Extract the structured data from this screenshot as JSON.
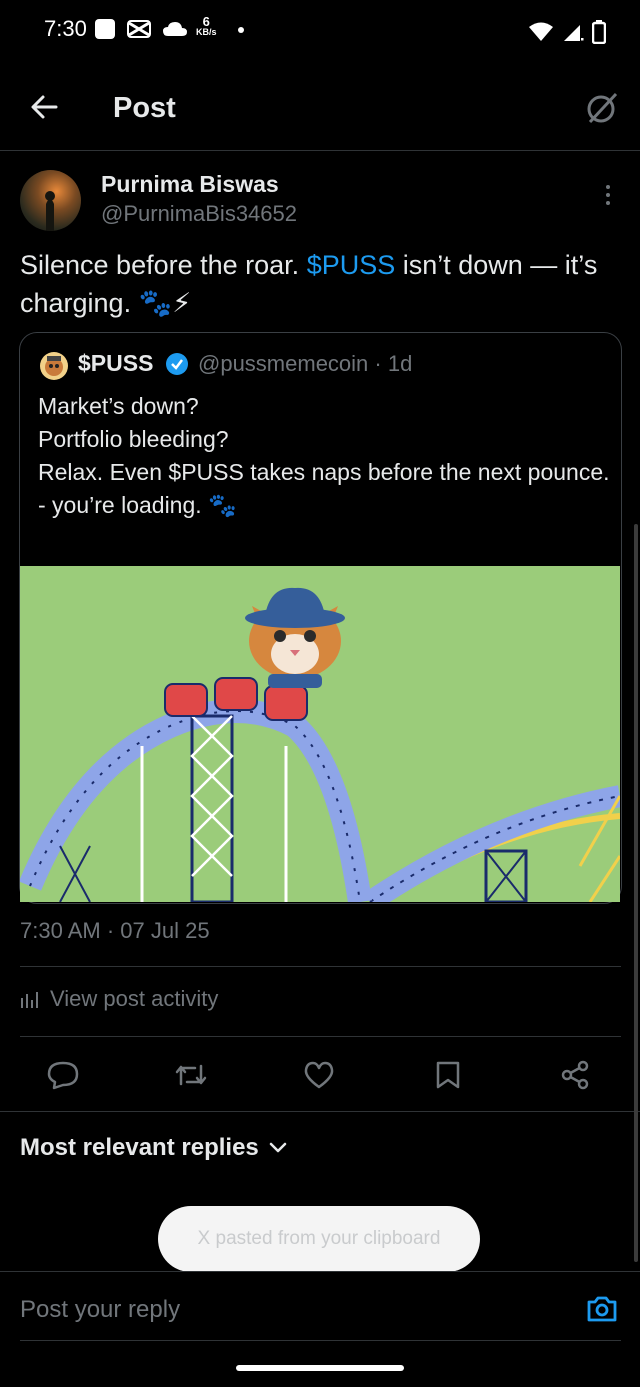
{
  "status_bar": {
    "time": "7:30",
    "net_speed_value": "6",
    "net_speed_unit": "KB/s"
  },
  "header": {
    "title": "Post"
  },
  "post": {
    "author_name": "Purnima Biswas",
    "author_handle": "@PurnimaBis34652",
    "text_part1": "Silence before the roar. ",
    "cashtag": "$PUSS",
    "text_part2": " isn’t down — it’s charging. 🐾⚡",
    "timestamp": "7:30 AM · 07 Jul 25"
  },
  "quoted_post": {
    "name": "$PUSS",
    "handle_time": "@pussmemecoin · 1d",
    "lines": [
      "Market’s down?",
      "Portfolio bleeding?",
      "Relax. Even $PUSS takes naps before the next pounce.",
      "- you’re loading. 🐾"
    ]
  },
  "activity": {
    "label": "View post activity",
    "icon": "bar-chart-icon"
  },
  "actions": {
    "icons": [
      "reply-icon",
      "repost-icon",
      "like-icon",
      "bookmark-icon",
      "share-icon"
    ]
  },
  "replies": {
    "sort_label": "Most relevant replies"
  },
  "toast": {
    "text": "X pasted from your clipboard"
  },
  "reply_box": {
    "placeholder": "Post your reply"
  },
  "colors": {
    "accent": "#1d9bf0",
    "background": "#000000",
    "secondary_text": "#71767b",
    "divider": "#2f3336"
  }
}
